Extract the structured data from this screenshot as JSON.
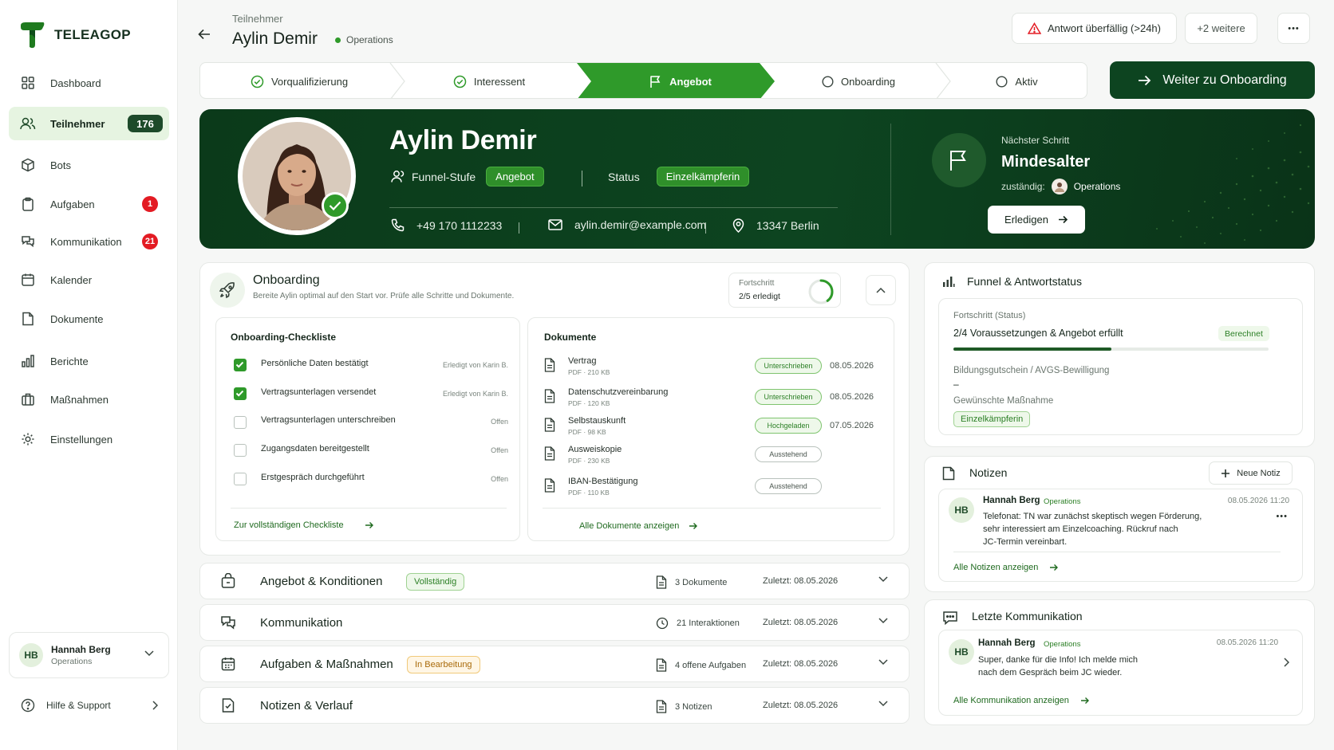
{
  "sidebar": {
    "logo": "TELEAGOP",
    "items": [
      {
        "label": "Dashboard",
        "icon": "grid-icon"
      },
      {
        "label": "Teilnehmer",
        "icon": "users-icon",
        "badge": "176"
      },
      {
        "label": "Bots",
        "icon": "bot-icon"
      },
      {
        "label": "Aufgaben",
        "icon": "clipboard-icon",
        "badge": "1"
      },
      {
        "label": "Kommunikation",
        "icon": "chat-icon",
        "badge": "21"
      },
      {
        "label": "Kalender",
        "icon": "calendar-icon"
      },
      {
        "label": "Dokumente",
        "icon": "document-icon"
      },
      {
        "label": "Berichte",
        "icon": "bar-chart-icon"
      },
      {
        "label": "Maßnahmen",
        "icon": "briefcase-icon"
      },
      {
        "label": "Einstellungen",
        "icon": "gear-icon"
      }
    ],
    "user": {
      "initials": "HB",
      "name": "Hannah Berg",
      "role": "Operations"
    },
    "help": "Hilfe & Support"
  },
  "header": {
    "breadcrumb": "Teilnehmer",
    "title": "Aylin Demir",
    "team": "Operations",
    "alert": "Antwort überfällig (>24h)",
    "more": "+2 weitere",
    "menu": "•••"
  },
  "stepper": {
    "steps": [
      {
        "label": "Vorqualifizierung",
        "state": "done"
      },
      {
        "label": "Interessent",
        "state": "done"
      },
      {
        "label": "Angebot",
        "state": "active"
      },
      {
        "label": "Onboarding",
        "state": "open"
      },
      {
        "label": "Aktiv",
        "state": "open"
      }
    ],
    "next_button": "Weiter zu Onboarding"
  },
  "hero": {
    "name": "Aylin Demir",
    "funnel_label": "Funnel-Stufe",
    "funnel_value": "Angebot",
    "status_label": "Status",
    "status_value": "Einzelkämpferin",
    "phone": "+49 170 1112233",
    "email": "aylin.demir@example.com",
    "location": "13347 Berlin",
    "next_step_label": "Nächster Schritt",
    "next_step_value": "Mindesalter",
    "owner_label": "zuständig:",
    "owner_value": "Operations",
    "done_button": "Erledigen"
  },
  "onboarding": {
    "title": "Onboarding",
    "subtitle": "Bereite Aylin optimal auf den Start vor. Prüfe alle Schritte und Dokumente.",
    "progress_label": "Fortschritt",
    "progress_value": "2/5 erledigt",
    "progress_fraction": 0.4,
    "checklist_title": "Onboarding-Checkliste",
    "checklist": [
      {
        "label": "Persönliche Daten bestätigt",
        "state": "Erledigt von Karin B.",
        "checked": true
      },
      {
        "label": "Vertragsunterlagen versendet",
        "state": "Erledigt von Karin B.",
        "checked": true
      },
      {
        "label": "Vertragsunterlagen unterschreiben",
        "state": "Offen",
        "checked": false
      },
      {
        "label": "Zugangsdaten bereitgestellt",
        "state": "Offen",
        "checked": false
      },
      {
        "label": "Erstgespräch durchgeführt",
        "state": "Offen",
        "checked": false
      }
    ],
    "checklist_link": "Zur vollständigen Checkliste",
    "docs_title": "Dokumente",
    "docs": [
      {
        "name": "Vertrag",
        "meta": "PDF · 210 KB",
        "badge": "Unterschrieben",
        "date": "08.05.2026",
        "tone": "g"
      },
      {
        "name": "Datenschutzvereinbarung",
        "meta": "PDF · 120 KB",
        "badge": "Unterschrieben",
        "date": "08.05.2026",
        "tone": "g"
      },
      {
        "name": "Selbstauskunft",
        "meta": "PDF · 98 KB",
        "badge": "Hochgeladen",
        "date": "07.05.2026",
        "tone": "g"
      },
      {
        "name": "Ausweiskopie",
        "meta": "PDF · 230 KB",
        "badge": "Ausstehend",
        "date": "",
        "tone": "n"
      },
      {
        "name": "IBAN-Bestätigung",
        "meta": "PDF · 110 KB",
        "badge": "Ausstehend",
        "date": "",
        "tone": "n"
      }
    ],
    "docs_link": "Alle Dokumente anzeigen"
  },
  "accordions": [
    {
      "title": "Angebot & Konditionen",
      "tag": "Vollständig",
      "tag_tone": "green",
      "meta": "3 Dokumente",
      "date": "Zuletzt:  08.05.2026",
      "icon": "bag-icon",
      "meta_icon": "document-icon"
    },
    {
      "title": "Kommunikation",
      "tag": "",
      "tag_tone": "",
      "meta": "21 Interaktionen",
      "date": "Zuletzt:  08.05.2026",
      "icon": "chat-icon",
      "meta_icon": "clock-icon"
    },
    {
      "title": "Aufgaben & Maßnahmen",
      "tag": "In Bearbeitung",
      "tag_tone": "amber",
      "meta": "4 offene Aufgaben",
      "date": "Zuletzt:  08.05.2026",
      "icon": "calendar-icon",
      "meta_icon": "document-icon"
    },
    {
      "title": "Notizen & Verlauf",
      "tag": "",
      "tag_tone": "",
      "meta": "3 Notizen",
      "date": "Zuletzt:  08.05.2026",
      "icon": "note-check-icon",
      "meta_icon": "document-icon"
    }
  ],
  "funnel": {
    "title": "Funnel & Antwortstatus",
    "progress_label": "Fortschritt (Status)",
    "progress_value": "2/4 Voraussetzungen & Angebot erfüllt",
    "progress_fraction": 0.5,
    "badge": "Berechnet",
    "voucher_label": "Bildungsgutschein / AVGS-Bewilligung",
    "voucher_value": "–",
    "measure_label": "Gewünschte Maßnahme",
    "measure_value": "Einzelkämpferin"
  },
  "notes": {
    "title": "Notizen",
    "new_button": "Neue Notiz",
    "author": "Hannah Berg",
    "initials": "HB",
    "team": "Operations",
    "time": "08.05.2026 11:20",
    "text_lines": [
      "Telefonat: TN war zunächst skeptisch wegen Förderung,",
      "sehr interessiert am Einzelcoaching. Rückruf nach",
      "JC-Termin vereinbart."
    ],
    "link": "Alle Notizen anzeigen"
  },
  "comms": {
    "title": "Letzte Kommunikation",
    "author": "Hannah Berg",
    "initials": "HB",
    "team": "Operations",
    "time": "08.05.2026 11:20",
    "text_lines": [
      "Super, danke für die Info! Ich melde mich",
      "nach dem Gespräch beim JC wieder."
    ],
    "link": "Alle Kommunikation anzeigen"
  },
  "colors": {
    "brand_dark": "#0d4420",
    "brand": "#2f9a2a",
    "alert": "#e31b23"
  }
}
